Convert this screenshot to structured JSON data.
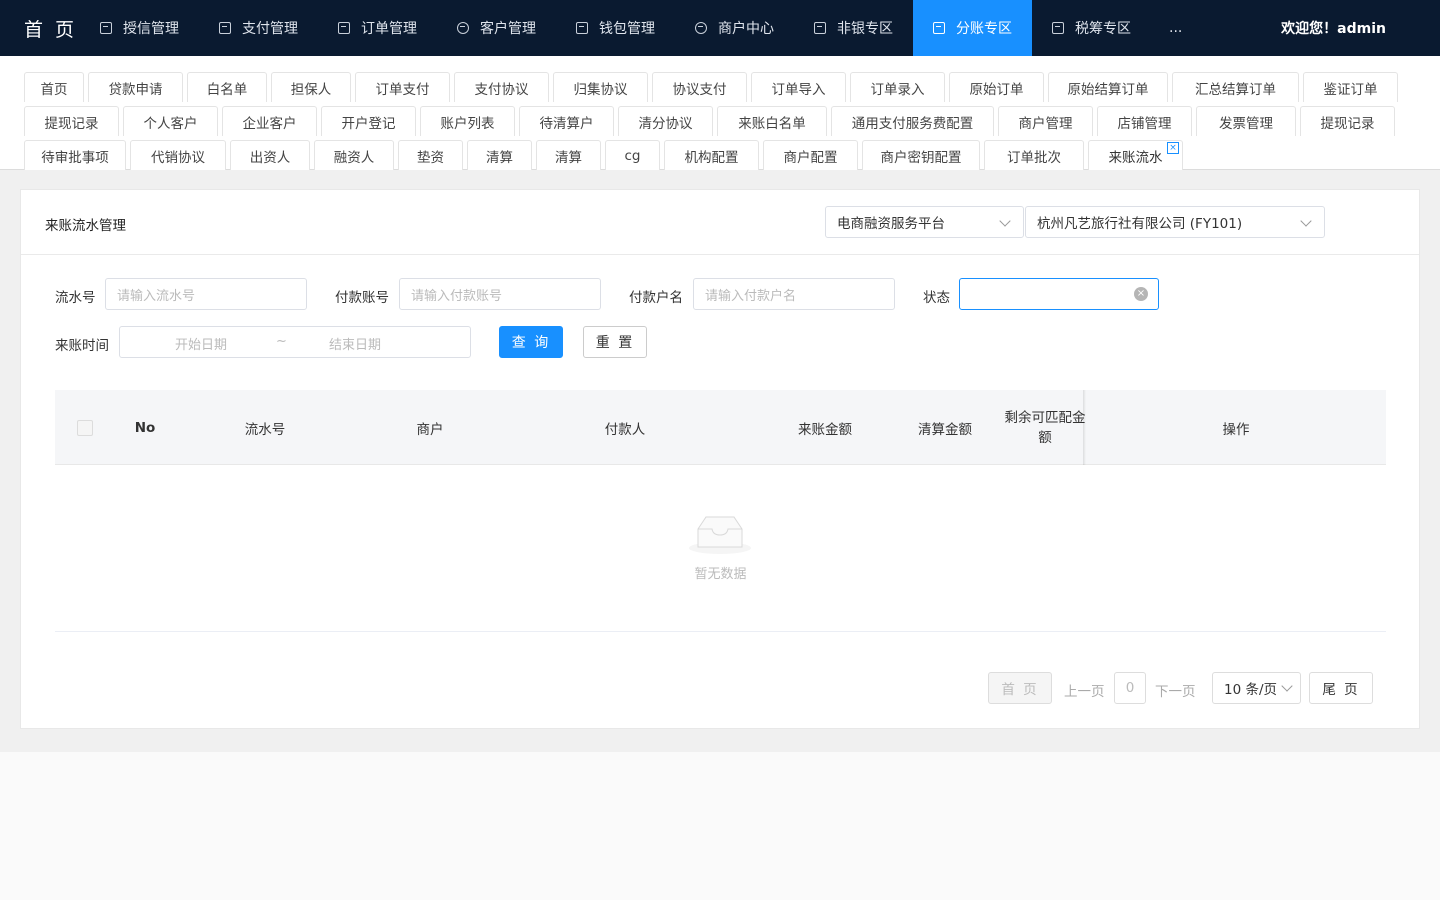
{
  "nav": {
    "brand": "首 页",
    "items": [
      {
        "label": "授信管理",
        "active": false
      },
      {
        "label": "支付管理",
        "active": false
      },
      {
        "label": "订单管理",
        "active": false
      },
      {
        "label": "客户管理",
        "active": false
      },
      {
        "label": "钱包管理",
        "active": false
      },
      {
        "label": "商户中心",
        "active": false
      },
      {
        "label": "非银专区",
        "active": false
      },
      {
        "label": "分账专区",
        "active": true
      },
      {
        "label": "税筹专区",
        "active": false
      }
    ],
    "more": "...",
    "welcome": "欢迎您！admin"
  },
  "tabs": {
    "row1": [
      "首页",
      "贷款申请",
      "白名单",
      "担保人",
      "订单支付",
      "支付协议",
      "归集协议",
      "协议支付",
      "订单导入",
      "订单录入",
      "原始订单",
      "原始结算订单",
      "汇总结算订单",
      "鉴证订单"
    ],
    "row2": [
      "提现记录",
      "个人客户",
      "企业客户",
      "开户登记",
      "账户列表",
      "待清算户",
      "清分协议",
      "来账白名单",
      "通用支付服务费配置",
      "商户管理",
      "店铺管理",
      "发票管理",
      "提现记录"
    ],
    "row3": [
      "待审批事项",
      "代销协议",
      "出资人",
      "融资人",
      "垫资",
      "清算",
      "清算",
      "cg",
      "机构配置",
      "商户配置",
      "商户密钥配置",
      "订单批次",
      "来账流水"
    ],
    "close_symbol": "×"
  },
  "card": {
    "title": "来账流水管理",
    "platform_select": "电商融资服务平台",
    "company_select": "杭州凡艺旅行社有限公司 (FY101)"
  },
  "filters": {
    "serial_label": "流水号",
    "serial_placeholder": "请输入流水号",
    "account_label": "付款账号",
    "account_placeholder": "请输入付款账号",
    "payer_name_label": "付款户名",
    "payer_name_placeholder": "请输入付款户名",
    "status_label": "状态",
    "status_value": "",
    "clear_symbol": "×",
    "time_label": "来账时间",
    "start_placeholder": "开始日期",
    "range_sep": "~",
    "end_placeholder": "结束日期",
    "query_button": "查 询",
    "reset_button": "重 置"
  },
  "table": {
    "columns": [
      "No",
      "流水号",
      "商户",
      "付款人",
      "来账金额",
      "清算金额",
      "剩余可匹配金额",
      "操作"
    ],
    "empty_text": "暂无数据"
  },
  "pagination": {
    "first": "首 页",
    "prev": "上一页",
    "page": "0",
    "next": "下一页",
    "page_size": "10 条/页",
    "last": "尾 页"
  },
  "colors": {
    "accent": "#1890ff",
    "nav_bg": "#0a1a30"
  }
}
